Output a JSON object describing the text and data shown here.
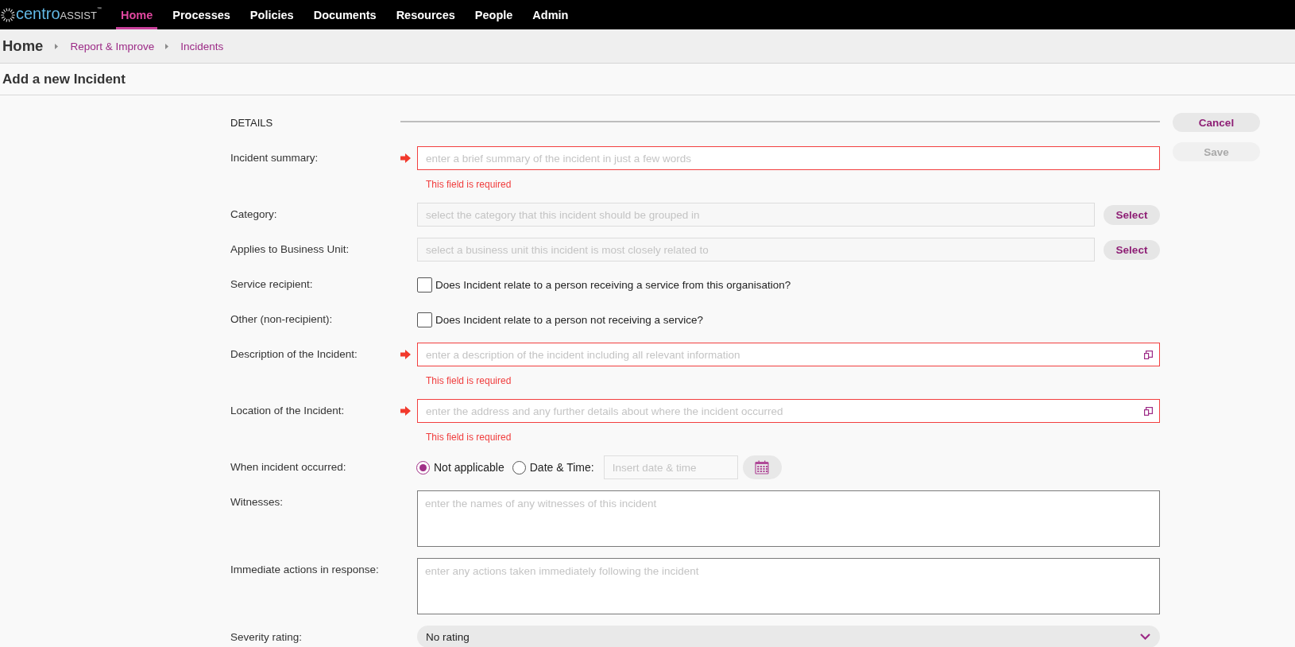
{
  "top_nav": {
    "logo": {
      "name_parts": [
        "centro",
        "ASSIST"
      ],
      "trademark": "™"
    },
    "items": [
      {
        "label": "Home",
        "selected": true
      },
      {
        "label": "Processes",
        "selected": false
      },
      {
        "label": "Policies",
        "selected": false
      },
      {
        "label": "Documents",
        "selected": false
      },
      {
        "label": "Resources",
        "selected": false
      },
      {
        "label": "People",
        "selected": false
      },
      {
        "label": "Admin",
        "selected": false
      }
    ]
  },
  "breadcrumb": [
    {
      "label": "Home",
      "kind": "root"
    },
    {
      "label": "Report & Improve",
      "kind": "link"
    },
    {
      "label": "Incidents",
      "kind": "link"
    }
  ],
  "page_title": "Add a new Incident",
  "form": {
    "section_title": "DETAILS",
    "fields": [
      {
        "kind": "text",
        "label": "Incident summary:",
        "required": true,
        "placeholder": "enter a brief summary of the incident in just a few words",
        "error": "This field is required",
        "expandable": false
      },
      {
        "kind": "picker",
        "label": "Category:",
        "placeholder": "select the category that this incident should be grouped in",
        "button": "Select"
      },
      {
        "kind": "picker",
        "label": "Applies to Business Unit:",
        "placeholder": "select a business unit this incident is most closely related to",
        "button": "Select"
      },
      {
        "kind": "checkbox",
        "label": "Service recipient:",
        "text": "Does Incident relate to a person receiving a service from this organisation?",
        "checked": false
      },
      {
        "kind": "checkbox",
        "label": "Other (non-recipient):",
        "text": "Does Incident relate to a person not receiving a service?",
        "checked": false
      },
      {
        "kind": "text",
        "label": "Description of the Incident:",
        "required": true,
        "placeholder": "enter a description of the incident including all relevant information",
        "error": "This field is required",
        "expandable": true
      },
      {
        "kind": "text",
        "label": "Location of the Incident:",
        "required": true,
        "placeholder": "enter the address and any further details about where the incident occurred",
        "error": "This field is required",
        "expandable": true
      },
      {
        "kind": "radio",
        "label": "When incident occurred:",
        "options": [
          {
            "label": "Not applicable",
            "selected": true
          },
          {
            "label": "Date & Time:",
            "selected": false
          }
        ],
        "date_placeholder": "Insert date & time"
      },
      {
        "kind": "textarea",
        "label": "Witnesses:",
        "placeholder": "enter the names of any witnesses of this incident"
      },
      {
        "kind": "textarea",
        "label": "Immediate actions in response:",
        "placeholder": "enter any actions taken immediately following the incident"
      },
      {
        "kind": "select",
        "label": "Severity rating:",
        "value": "No rating"
      }
    ]
  },
  "actions": [
    {
      "label": "Cancel",
      "disabled": false
    },
    {
      "label": "Save",
      "disabled": true
    }
  ]
}
